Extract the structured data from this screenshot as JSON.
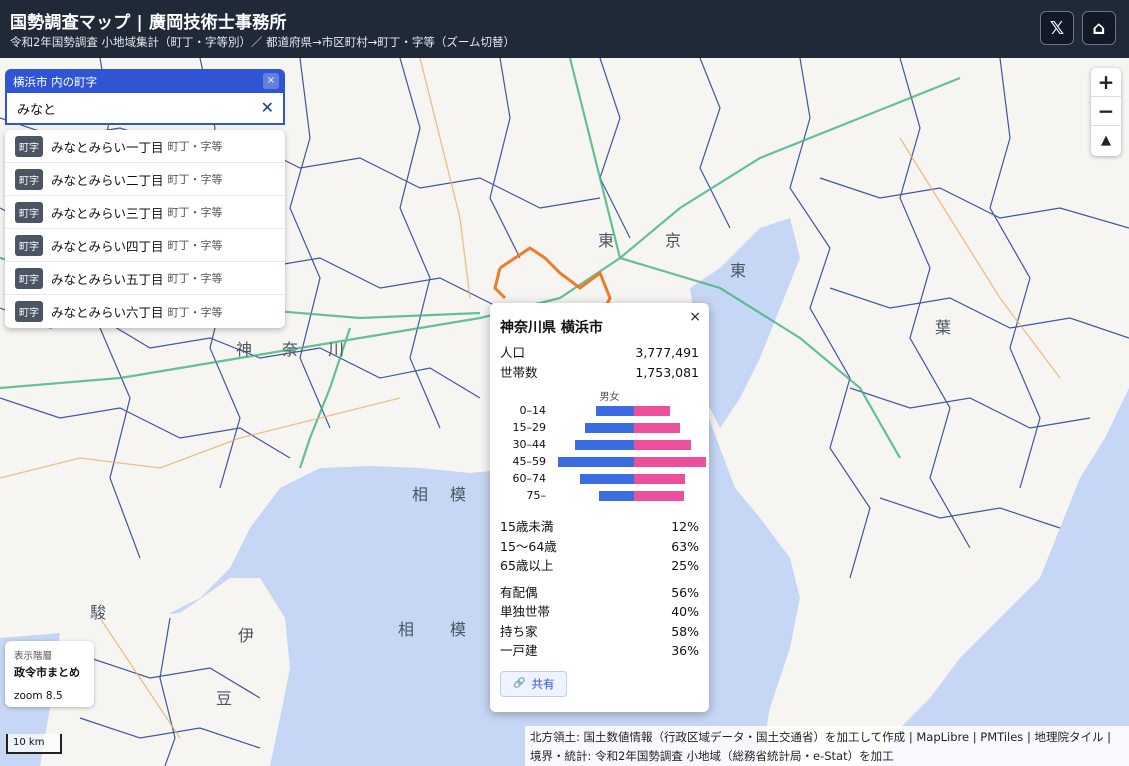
{
  "header": {
    "title": "国勢調査マップ | 廣岡技術士事務所",
    "subtitle": "令和2年国勢調査 小地域集計（町丁・字等別）／ 都道府県→市区町村→町丁・字等（ズーム切替）",
    "x_button_glyph": "𝕏",
    "home_button_glyph": "⌂"
  },
  "search": {
    "header_label": "横浜市 内の町字",
    "close_glyph": "×",
    "query": "みなと",
    "clear_glyph": "✕",
    "results": [
      {
        "badge": "町字",
        "name": "みなとみらい一丁目",
        "kind": "町丁・字等"
      },
      {
        "badge": "町字",
        "name": "みなとみらい二丁目",
        "kind": "町丁・字等"
      },
      {
        "badge": "町字",
        "name": "みなとみらい三丁目",
        "kind": "町丁・字等"
      },
      {
        "badge": "町字",
        "name": "みなとみらい四丁目",
        "kind": "町丁・字等"
      },
      {
        "badge": "町字",
        "name": "みなとみらい五丁目",
        "kind": "町丁・字等"
      },
      {
        "badge": "町字",
        "name": "みなとみらい六丁目",
        "kind": "町丁・字等"
      }
    ]
  },
  "zoom_control": {
    "zoom_in": "+",
    "zoom_out": "−",
    "compass": "▲"
  },
  "layer_info": {
    "label": "表示階層",
    "value": "政令市まとめ",
    "zoom": "zoom 8.5"
  },
  "scale_bar": {
    "label": "10 km"
  },
  "attribution": {
    "line1_text": "北方領土: 国土数値情報（行政区域データ・国土交通省）を加工して作成 |",
    "maplibre": "MapLibre",
    "sep1": "|",
    "pmtiles": "PMTiles",
    "sep2": "|",
    "gsi": "地理院タイル",
    "sep3": "|",
    "line2_text": "境界・統計: 令和2年国勢調査 小地域（総務省統計局・e-Stat）を加工"
  },
  "map_labels": [
    "東",
    "京",
    "東",
    "葉",
    "神",
    "奈",
    "川",
    "相",
    "模",
    "相",
    "模",
    "駿",
    "伊",
    "豆"
  ],
  "popup": {
    "close_glyph": "×",
    "name": "神奈川県 横浜市",
    "stats": [
      {
        "label": "人口",
        "value": "3,777,491"
      },
      {
        "label": "世帯数",
        "value": "1,753,081"
      }
    ],
    "pyramid_title": "男女",
    "pyramid": [
      {
        "age": "0–14",
        "male": 0.28,
        "female": 0.27
      },
      {
        "age": "15–29",
        "male": 0.36,
        "female": 0.34
      },
      {
        "age": "30–44",
        "male": 0.44,
        "female": 0.42
      },
      {
        "age": "45–59",
        "male": 0.56,
        "female": 0.53
      },
      {
        "age": "60–74",
        "male": 0.4,
        "female": 0.38
      },
      {
        "age": "75–",
        "male": 0.26,
        "female": 0.37
      }
    ],
    "age_shares": [
      {
        "label": "15歳未満",
        "value": "12%"
      },
      {
        "label": "15〜64歳",
        "value": "63%"
      },
      {
        "label": "65歳以上",
        "value": "25%"
      }
    ],
    "household": [
      {
        "label": "有配偶",
        "value": "56%"
      },
      {
        "label": "単独世帯",
        "value": "40%"
      },
      {
        "label": "持ち家",
        "value": "58%"
      },
      {
        "label": "一戸建",
        "value": "36%"
      }
    ],
    "share_icon": "🔗",
    "share_label": "共有"
  },
  "colors": {
    "header_bg": "#1f2937",
    "accent": "#2f55d4",
    "sea": "#c6d6f5",
    "land": "#f6f5f2",
    "boundary": "#233a8c",
    "highlight": "#f07a28",
    "male": "#3b6de0",
    "female": "#ec4f9b"
  }
}
